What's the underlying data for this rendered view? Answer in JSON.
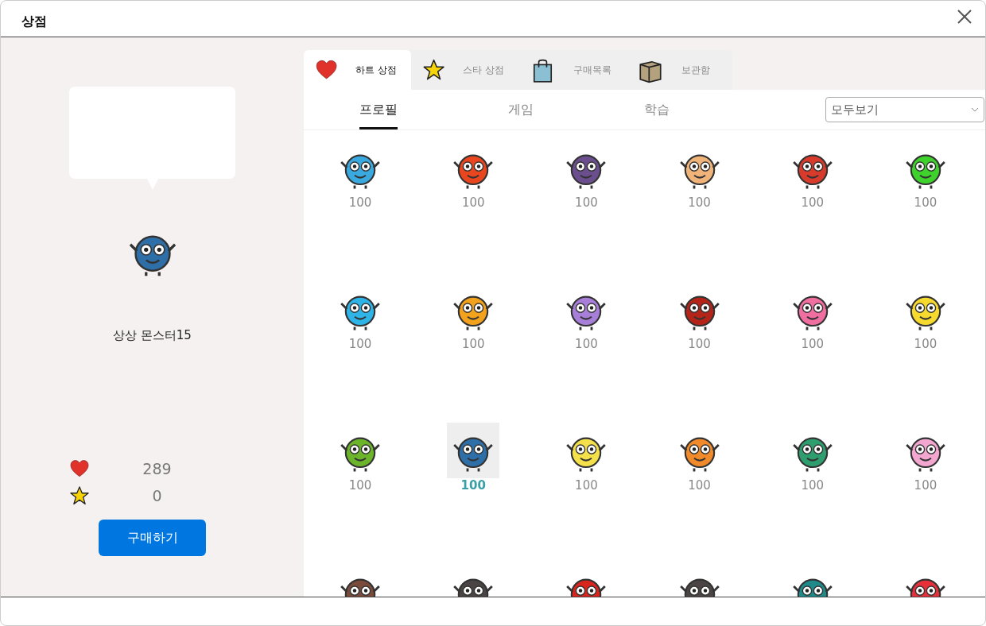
{
  "window": {
    "title": "상점"
  },
  "preview": {
    "name": "상상 몬스터15",
    "color": "#2f6fa8"
  },
  "balance": [
    {
      "kind": "heart",
      "value": "289"
    },
    {
      "kind": "star",
      "value": "0"
    }
  ],
  "buy_button": "구매하기",
  "shop_tabs": [
    {
      "kind": "heart",
      "label": "하트 상점",
      "selected": true
    },
    {
      "kind": "star",
      "label": "스타 상점",
      "selected": false
    },
    {
      "kind": "bag",
      "label": "구매목록",
      "selected": false
    },
    {
      "kind": "box",
      "label": "보관함",
      "selected": false
    }
  ],
  "category_tabs": [
    {
      "label": "프로필",
      "selected": true
    },
    {
      "label": "게임",
      "selected": false
    },
    {
      "label": "학습",
      "selected": false
    }
  ],
  "filter": {
    "value": "모두보기"
  },
  "items": [
    {
      "color": "#3aa9e0",
      "price": "100",
      "selected": false
    },
    {
      "color": "#e8461e",
      "price": "100",
      "selected": false
    },
    {
      "color": "#6b4e8e",
      "price": "100",
      "selected": false
    },
    {
      "color": "#f0b47a",
      "price": "100",
      "selected": false
    },
    {
      "color": "#d83a2c",
      "price": "100",
      "selected": false
    },
    {
      "color": "#3fd12c",
      "price": "100",
      "selected": false
    },
    {
      "color": "#2fb4e8",
      "price": "100",
      "selected": false
    },
    {
      "color": "#f2a21c",
      "price": "100",
      "selected": false
    },
    {
      "color": "#a77fd8",
      "price": "100",
      "selected": false
    },
    {
      "color": "#b52418",
      "price": "100",
      "selected": false
    },
    {
      "color": "#f06ea0",
      "price": "100",
      "selected": false
    },
    {
      "color": "#f7da2e",
      "price": "100",
      "selected": false
    },
    {
      "color": "#6cb52a",
      "price": "100",
      "selected": false
    },
    {
      "color": "#2f6fa8",
      "price": "100",
      "selected": true
    },
    {
      "color": "#f4e04a",
      "price": "100",
      "selected": false
    },
    {
      "color": "#f08a2a",
      "price": "100",
      "selected": false
    },
    {
      "color": "#2e9e6e",
      "price": "100",
      "selected": false
    },
    {
      "color": "#f2a6d0",
      "price": "100",
      "selected": false
    },
    {
      "color": "#7a4a3a",
      "selected": false
    },
    {
      "color": "#4a4444",
      "selected": false
    },
    {
      "color": "#d8261e",
      "selected": false
    },
    {
      "color": "#4a4444",
      "selected": false
    },
    {
      "color": "#1f8a8a",
      "selected": false
    },
    {
      "color": "#e8303a",
      "selected": false
    }
  ]
}
